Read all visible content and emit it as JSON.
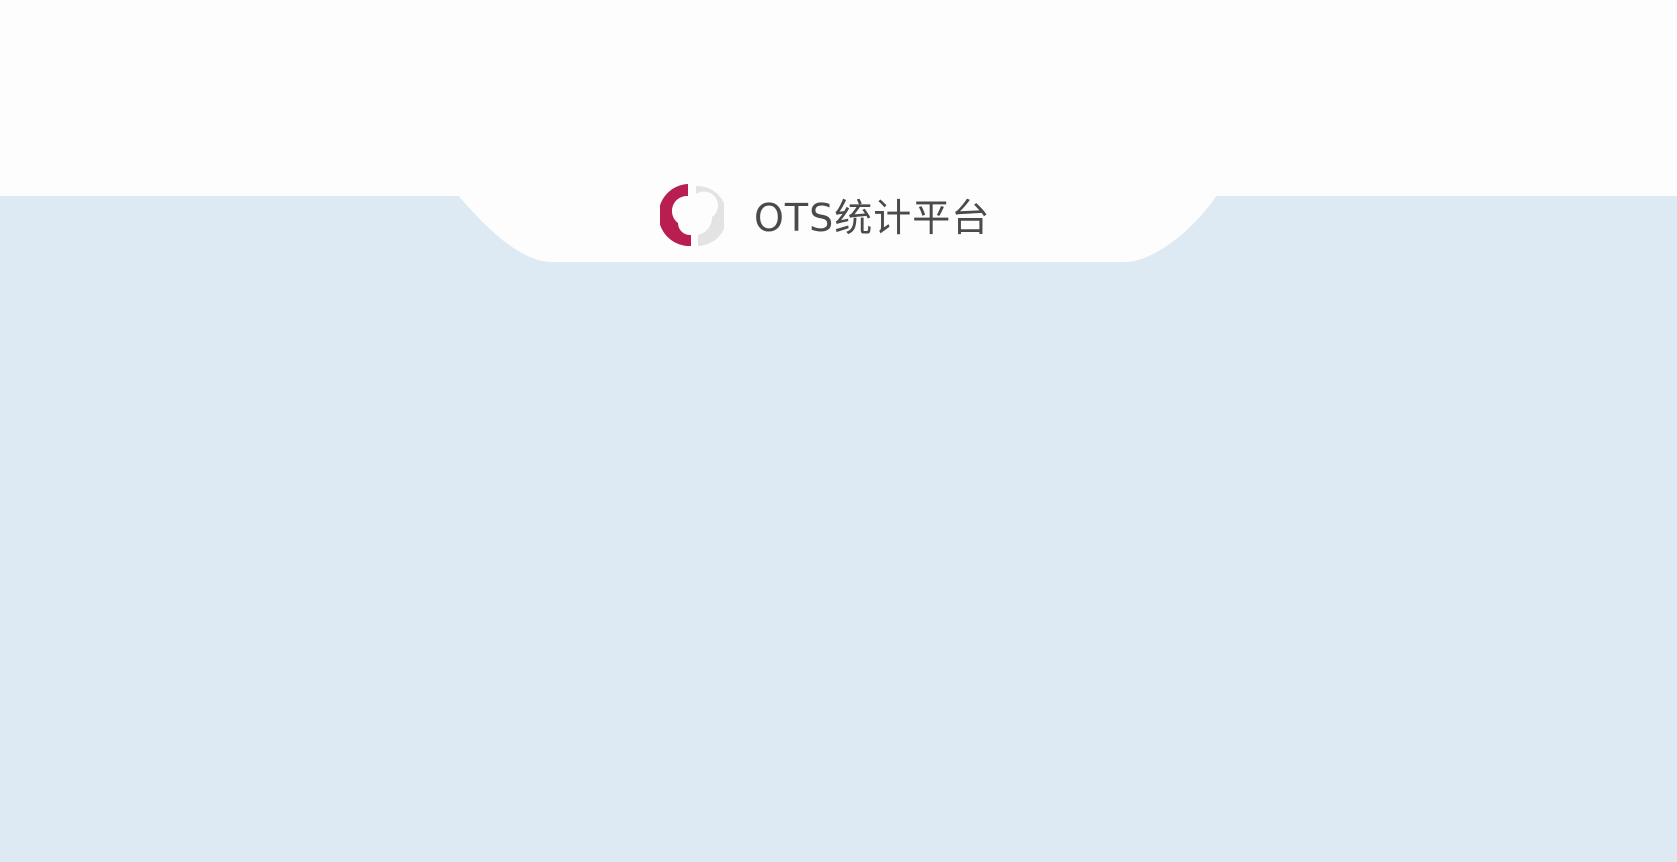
{
  "header": {
    "title": "OTS统计平台",
    "logo_icon": "brand-logo-icon"
  },
  "colors": {
    "background": "#ddeaf3",
    "header_background": "#fdfdfd",
    "logo_primary": "#b81e4f",
    "logo_secondary": "#e3e3e3",
    "title_text": "#4a4a4a"
  }
}
